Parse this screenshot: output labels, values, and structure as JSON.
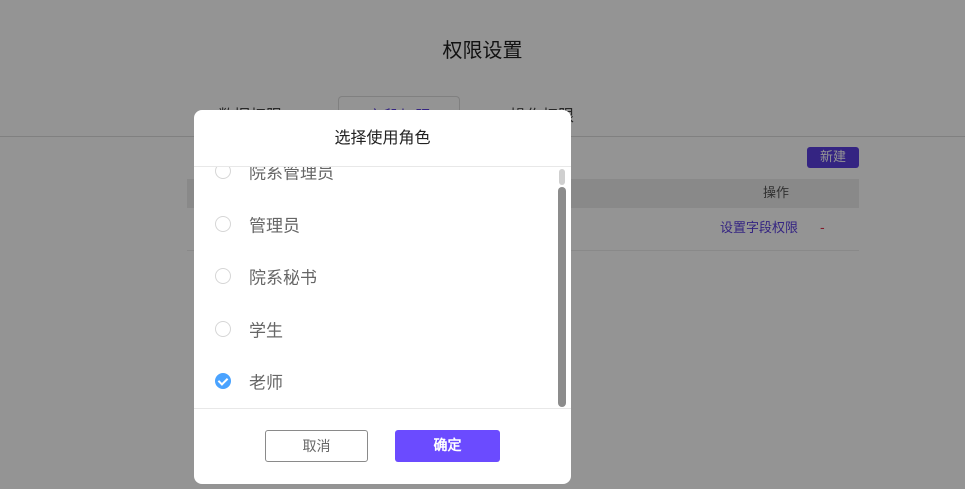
{
  "page": {
    "title": "权限设置",
    "tabs": [
      {
        "label": "数据权限"
      },
      {
        "label": "字段权限"
      },
      {
        "label": "操作权限"
      }
    ],
    "new_button": "新建",
    "table": {
      "op_header": "操作",
      "row_link": "设置字段权限",
      "row_dash": "-"
    }
  },
  "modal": {
    "title": "选择使用角色",
    "options": [
      {
        "label": "院系管理员",
        "checked": false
      },
      {
        "label": "管理员",
        "checked": false
      },
      {
        "label": "院系秘书",
        "checked": false
      },
      {
        "label": "学生",
        "checked": false
      },
      {
        "label": "老师",
        "checked": true
      }
    ],
    "cancel": "取消",
    "confirm": "确定"
  },
  "colors": {
    "accent": "#6b4bff",
    "check": "#4aa3ff"
  }
}
